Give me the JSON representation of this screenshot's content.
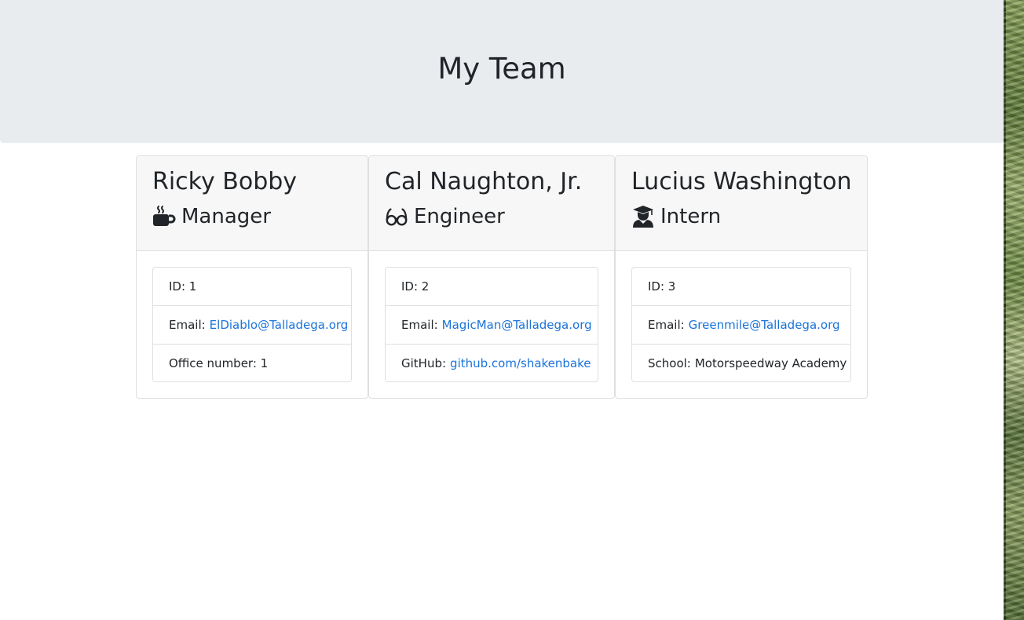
{
  "header": {
    "title": "My Team"
  },
  "colors": {
    "jumbotron_bg": "#e9ecef",
    "card_header_bg": "#f7f7f7",
    "link": "#1a73d9",
    "text": "#212529"
  },
  "team": [
    {
      "name": "Ricky Bobby",
      "role": "Manager",
      "icon": "mug-icon",
      "id_label": "ID: 1",
      "email_label": "Email:",
      "email": "ElDiablo@Talladega.org",
      "extra_label": "Office number: 1",
      "extra_link": ""
    },
    {
      "name": "Cal Naughton, Jr.",
      "role": "Engineer",
      "icon": "glasses-icon",
      "id_label": "ID: 2",
      "email_label": "Email:",
      "email": "MagicMan@Talladega.org",
      "extra_label": "GitHub:",
      "extra_link": "github.com/shakenbake"
    },
    {
      "name": "Lucius Washington",
      "role": "Intern",
      "icon": "graduate-icon",
      "id_label": "ID: 3",
      "email_label": "Email:",
      "email": "Greenmile@Talladega.org",
      "extra_label": "School:",
      "extra_value": "Motorspeedway Academy"
    }
  ]
}
